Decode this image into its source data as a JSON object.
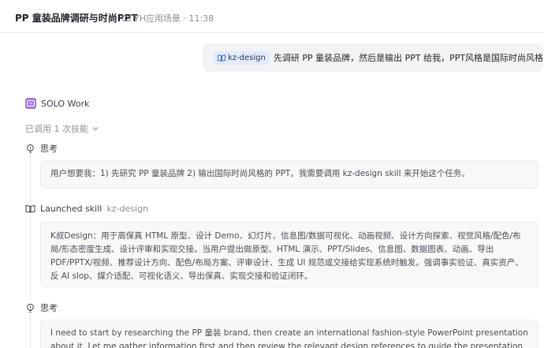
{
  "header": {
    "title": "PP 童装品牌调研与时尚PPT",
    "meta": "YH应用场景 · 11:38"
  },
  "user_message": {
    "skill_chip": "kz-design",
    "text": "先调研 PP 童装品牌，然后是输出 PPT 给我，PPT风格是国际时尚风格"
  },
  "agent": {
    "name": "SOLO Work",
    "skills_used": "已调用 1 次技能"
  },
  "steps": [
    {
      "label": "思考",
      "text": "用户想要我：1) 先研究 PP 童装品牌 2) 输出国际时尚风格的 PPT。我需要调用 kz-design skill 来开始这个任务。"
    },
    {
      "label": "Launched skill",
      "sub": "kz-design",
      "text": "K叔Design：用于高保真 HTML 原型、设计 Demo、幻灯片、信息图/数据可视化、动画视频、设计方向探索、视觉风格/配色/布局/形态密度生成、设计评审和实现交接。当用户提出做原型、HTML 演示、PPT/Slides、信息图、数据图表、动画、导出 PDF/PPTX/视频、推荐设计方向、配色/布局方案、评审设计、生成 UI 规范或交接给实现系统时触发。强调事实验证、真实资产、反 AI slop、媒介适配、可视化语义、导出保真、实现交接和验证闭环。"
    },
    {
      "label": "思考",
      "text": "I need to start by researching the PP 童装 brand, then create an international fashion-style PowerPoint presentation about it. Let me gather information first and then review the relevant design references to guide the presentation work."
    }
  ]
}
